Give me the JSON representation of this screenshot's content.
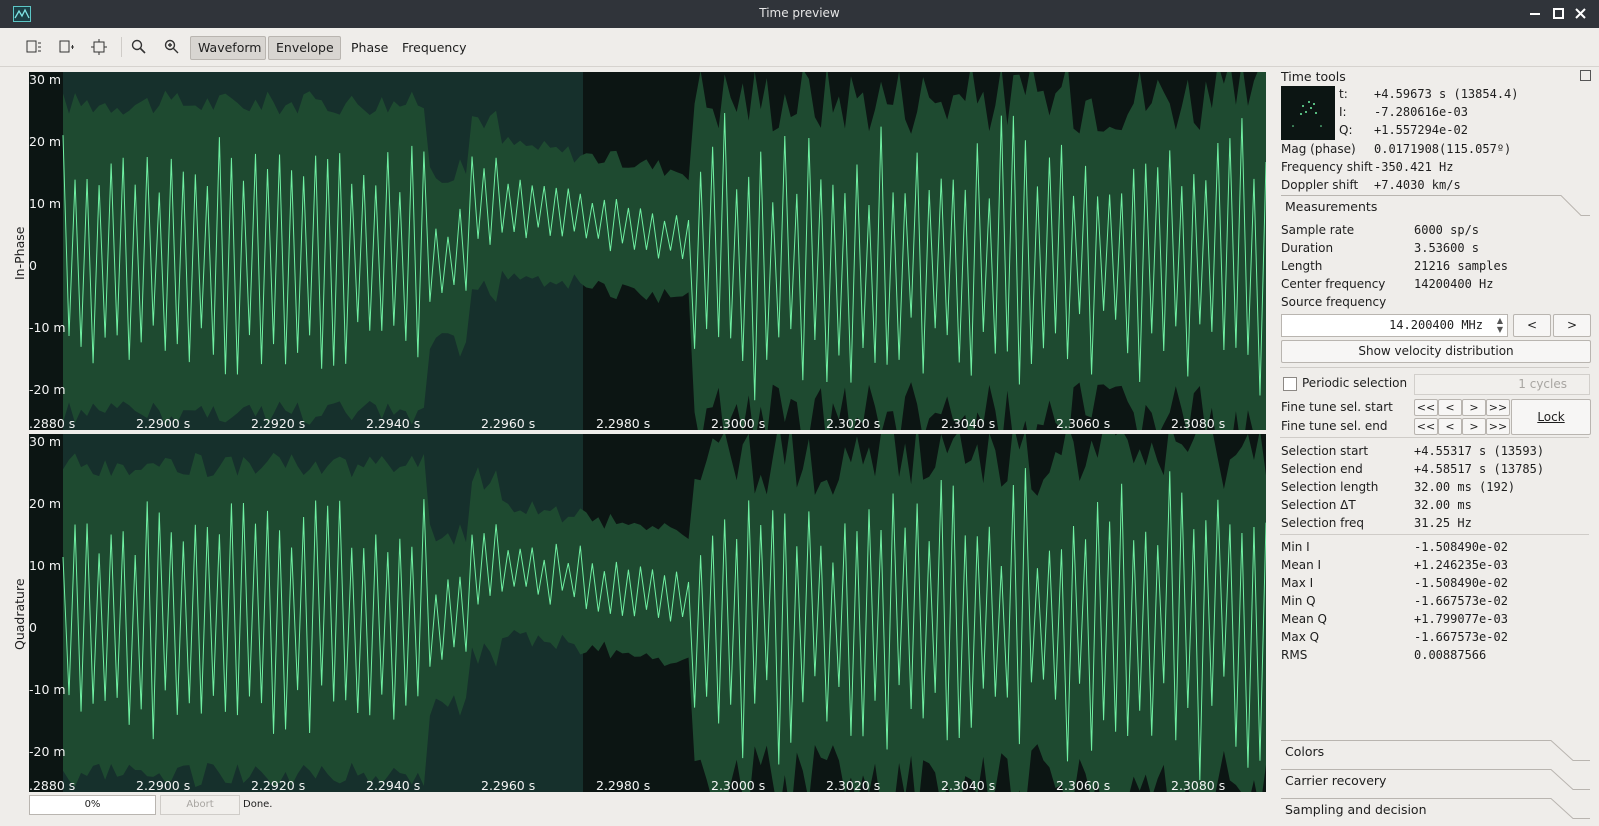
{
  "window": {
    "title": "Time preview"
  },
  "toolbar": {
    "tabs": [
      "Waveform",
      "Envelope",
      "Phase",
      "Frequency"
    ]
  },
  "plots": {
    "inphase": {
      "axis_label": "In-Phase",
      "y_ticks": [
        "30 m",
        "20 m",
        "10 m",
        "0",
        "-10 m",
        "-20 m"
      ],
      "x_ticks": [
        ".2880 s",
        "2.2900 s",
        "2.2920 s",
        "2.2940 s",
        "2.2960 s",
        "2.2980 s",
        "2.3000 s",
        "2.3020 s",
        "2.3040 s",
        "2.3060 s",
        "2.3080 s"
      ]
    },
    "quadrature": {
      "axis_label": "Quadrature",
      "y_ticks": [
        "30 m",
        "20 m",
        "10 m",
        "0",
        "-10 m",
        "-20 m"
      ],
      "x_ticks": [
        ".2880 s",
        "2.2900 s",
        "2.2920 s",
        "2.2940 s",
        "2.2960 s",
        "2.2980 s",
        "2.3000 s",
        "2.3020 s",
        "2.3040 s",
        "2.3060 s",
        "2.3080 s"
      ]
    },
    "colors": {
      "background": "#0c1513",
      "selection": "#16302c",
      "envelope": "#1e4a30",
      "trace": "#6ff0a2"
    }
  },
  "time_tools": {
    "title": "Time tools",
    "t_label": "t:",
    "t_value": "+4.59673 s (13854.4)",
    "i_label": "I:",
    "i_value": "-7.280616e-03",
    "q_label": "Q:",
    "q_value": "+1.557294e-02",
    "mag_label": "Mag (phase)",
    "mag_value": "0.0171908(115.057º)",
    "fshift_label": "Frequency shift",
    "fshift_value": "-350.421 Hz",
    "doppler_label": "Doppler shift",
    "doppler_value": "+7.4030 km/s"
  },
  "measurements": {
    "title": "Measurements",
    "sample_rate_label": "Sample rate",
    "sample_rate": "6000 sp/s",
    "duration_label": "Duration",
    "duration": "3.53600 s",
    "length_label": "Length",
    "length": "21216 samples",
    "center_label": "Center frequency",
    "center": "14200400 Hz",
    "source_label": "Source frequency",
    "source_value": "14.200400 MHz",
    "prev_label": "<",
    "next_label": ">",
    "velocity_button": "Show velocity distribution",
    "periodic_label": "Periodic selection",
    "periodic_checked": false,
    "cycles_value": "1 cycles",
    "finetune_start_label": "Fine tune sel. start",
    "finetune_end_label": "Fine tune sel. end",
    "finetune_buttons": [
      "<<",
      "<",
      ">",
      ">>"
    ],
    "lock_label": "Lock",
    "sel_start_label": "Selection start",
    "sel_start": "+4.55317 s (13593)",
    "sel_end_label": "Selection end",
    "sel_end": "+4.58517 s (13785)",
    "sel_len_label": "Selection length",
    "sel_len": "32.00 ms (192)",
    "sel_dt_label": "Selection ΔT",
    "sel_dt": "32.00 ms",
    "sel_freq_label": "Selection freq",
    "sel_freq": "31.25 Hz",
    "min_i_label": "Min I",
    "min_i": "-1.508490e-02",
    "mean_i_label": "Mean I",
    "mean_i": "+1.246235e-03",
    "max_i_label": "Max I",
    "max_i": "-1.508490e-02",
    "min_q_label": "Min Q",
    "min_q": "-1.667573e-02",
    "mean_q_label": "Mean Q",
    "mean_q": "+1.799077e-03",
    "max_q_label": "Max Q",
    "max_q": "-1.667573e-02",
    "rms_label": "RMS",
    "rms": "0.00887566"
  },
  "collapsed_sections": [
    "Colors",
    "Carrier recovery",
    "Sampling and decision"
  ],
  "status": {
    "progress": "0%",
    "abort_label": "Abort",
    "message": "Done."
  }
}
